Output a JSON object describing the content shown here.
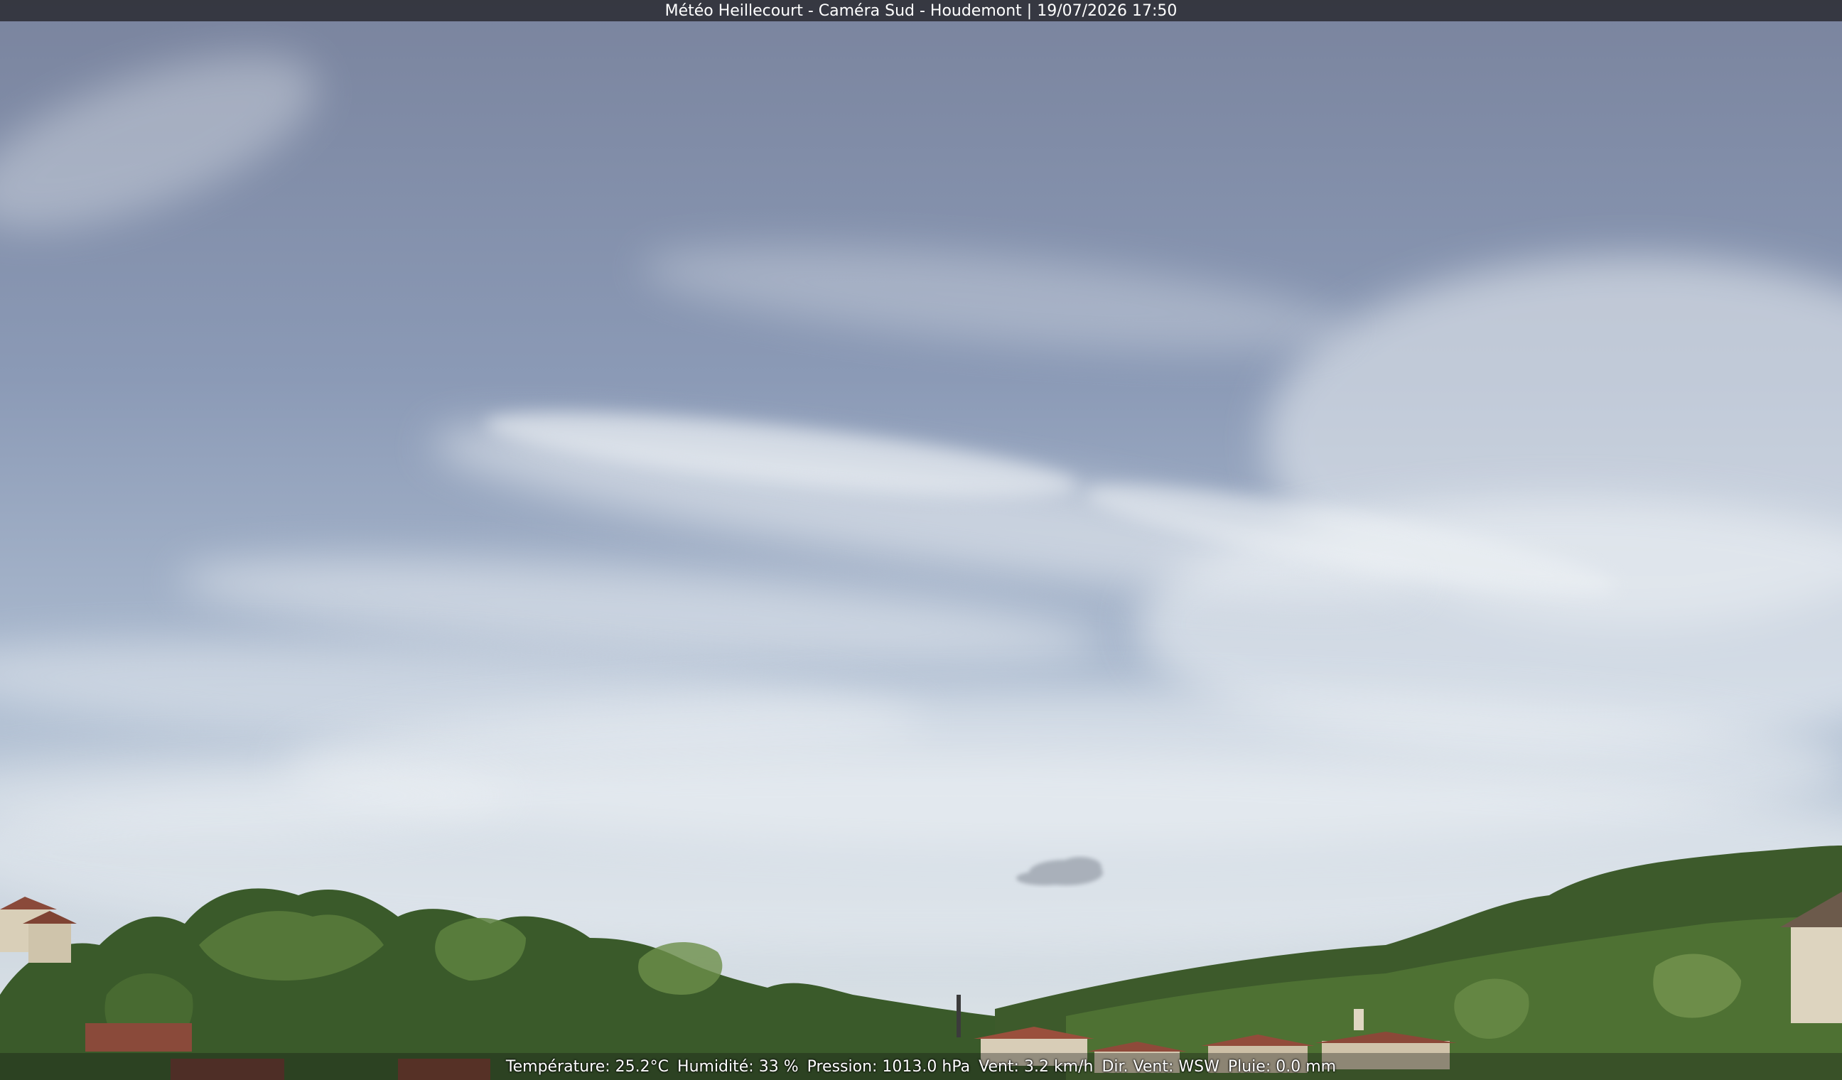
{
  "camera_title": "Météo Heillecourt - Caméra Sud - Houdemont | 19/07/2026 17:50",
  "weather": {
    "temperature": "Température: 25.2°C",
    "humidity": "Humidité: 33 %",
    "pressure": "Pression: 1013.0 hPa",
    "wind_speed": "Vent: 3.2 km/h",
    "wind_dir": "Dir. Vent: WSW",
    "rain": "Pluie: 0.0 mm"
  },
  "colors": {
    "sky_top": "#7f8aa4",
    "sky_mid": "#9fb0c9",
    "sky_horizon": "#dfe6ea",
    "cloud": "#e9eef2",
    "foliage_dark": "#2f4a22",
    "foliage": "#4d6e33",
    "foliage_light": "#6f8f48",
    "roof": "#8a4a3a",
    "wall": "#d9cfb8"
  }
}
